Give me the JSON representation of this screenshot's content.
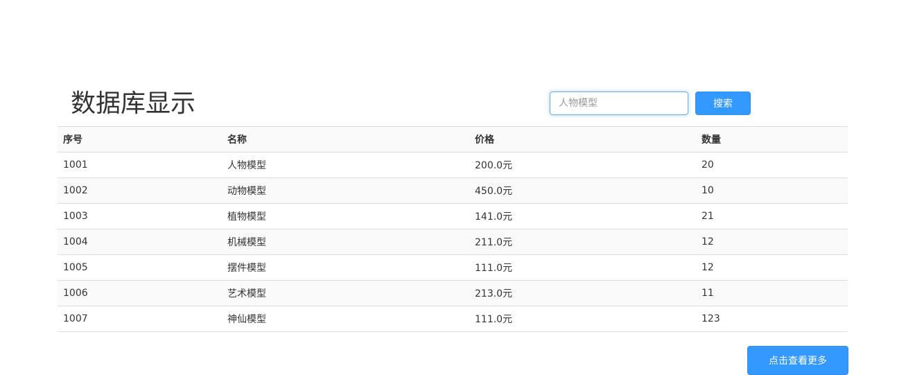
{
  "header": {
    "title": "数据库显示"
  },
  "search": {
    "placeholder": "人物模型",
    "value": "",
    "button_label": "搜索"
  },
  "table": {
    "columns": [
      "序号",
      "名称",
      "价格",
      "数量"
    ],
    "rows": [
      [
        "1001",
        "人物模型",
        "200.0元",
        "20"
      ],
      [
        "1002",
        "动物模型",
        "450.0元",
        "10"
      ],
      [
        "1003",
        "植物模型",
        "141.0元",
        "21"
      ],
      [
        "1004",
        "机械模型",
        "211.0元",
        "12"
      ],
      [
        "1005",
        "摆件模型",
        "111.0元",
        "12"
      ],
      [
        "1006",
        "艺术模型",
        "213.0元",
        "11"
      ],
      [
        "1007",
        "神仙模型",
        "111.0元",
        "123"
      ]
    ]
  },
  "footer": {
    "more_label": "点击查看更多"
  },
  "colors": {
    "accent": "#3399ff",
    "focus_border": "#66afe9",
    "stripe": "#f9f9f9",
    "border": "#dddddd"
  }
}
